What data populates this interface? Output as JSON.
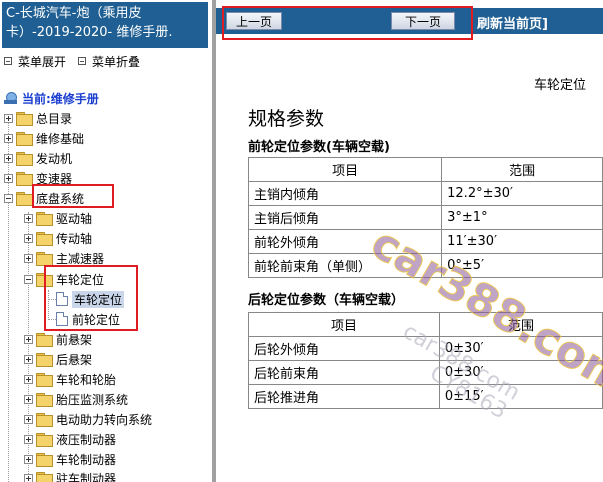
{
  "left_pane": {
    "doc_title": "C-长城汽车-炮（乘用皮卡）-2019-2020- 维修手册.",
    "menu_expand": "菜单展开",
    "menu_collapse": "菜单折叠",
    "current_label": "当前:维修手册",
    "tree": [
      {
        "label": "总目录",
        "state": "plus"
      },
      {
        "label": "维修基础",
        "state": "plus"
      },
      {
        "label": "发动机",
        "state": "plus"
      },
      {
        "label": "变速器",
        "state": "plus"
      },
      {
        "label": "底盘系统",
        "state": "minus"
      },
      {
        "label": "驱动轴",
        "state": "plus"
      },
      {
        "label": "传动轴",
        "state": "plus"
      },
      {
        "label": "主减速器",
        "state": "plus"
      },
      {
        "label": "车轮定位",
        "state": "minus"
      },
      {
        "label": "车轮定位",
        "state": "page",
        "selected": true
      },
      {
        "label": "前轮定位",
        "state": "page"
      },
      {
        "label": "前悬架",
        "state": "plus"
      },
      {
        "label": "后悬架",
        "state": "plus"
      },
      {
        "label": "车轮和轮胎",
        "state": "plus"
      },
      {
        "label": "胎压监测系统",
        "state": "plus"
      },
      {
        "label": "电动助力转向系统",
        "state": "plus"
      },
      {
        "label": "液压制动器",
        "state": "plus"
      },
      {
        "label": "车轮制动器",
        "state": "plus"
      },
      {
        "label": "驻车制动器",
        "state": "plus"
      }
    ]
  },
  "toolbar": {
    "prev_label": "上一页",
    "next_label": "下一页",
    "refresh_label": "刷新当前页]"
  },
  "content": {
    "section_header": "车轮定位",
    "spec_title": "规格参数",
    "front_caption": "前轮定位参数(车辆空载)",
    "front_headers": [
      "项目",
      "范围"
    ],
    "front_rows": [
      [
        "主销内倾角",
        "12.2°±30′"
      ],
      [
        "主销后倾角",
        "3°±1°"
      ],
      [
        "前轮外倾角",
        "11′±30′"
      ],
      [
        "前轮前束角（单侧）",
        "0°±5′"
      ]
    ],
    "rear_caption": "后轮定位参数（车辆空载）",
    "rear_headers": [
      "项目",
      "范围"
    ],
    "rear_rows": [
      [
        "后轮外倾角",
        "0±30′"
      ],
      [
        "后轮前束角",
        "0±30′"
      ],
      [
        "后轮推进角",
        "0±15′"
      ]
    ]
  },
  "watermark": {
    "main": "car388.com",
    "secondary": "car388.com",
    "tertiary": "CY8163"
  },
  "colors": {
    "title_bar": "#1f5f93",
    "highlight_box": "#e11b22",
    "link_blue": "#1a3ed0"
  }
}
